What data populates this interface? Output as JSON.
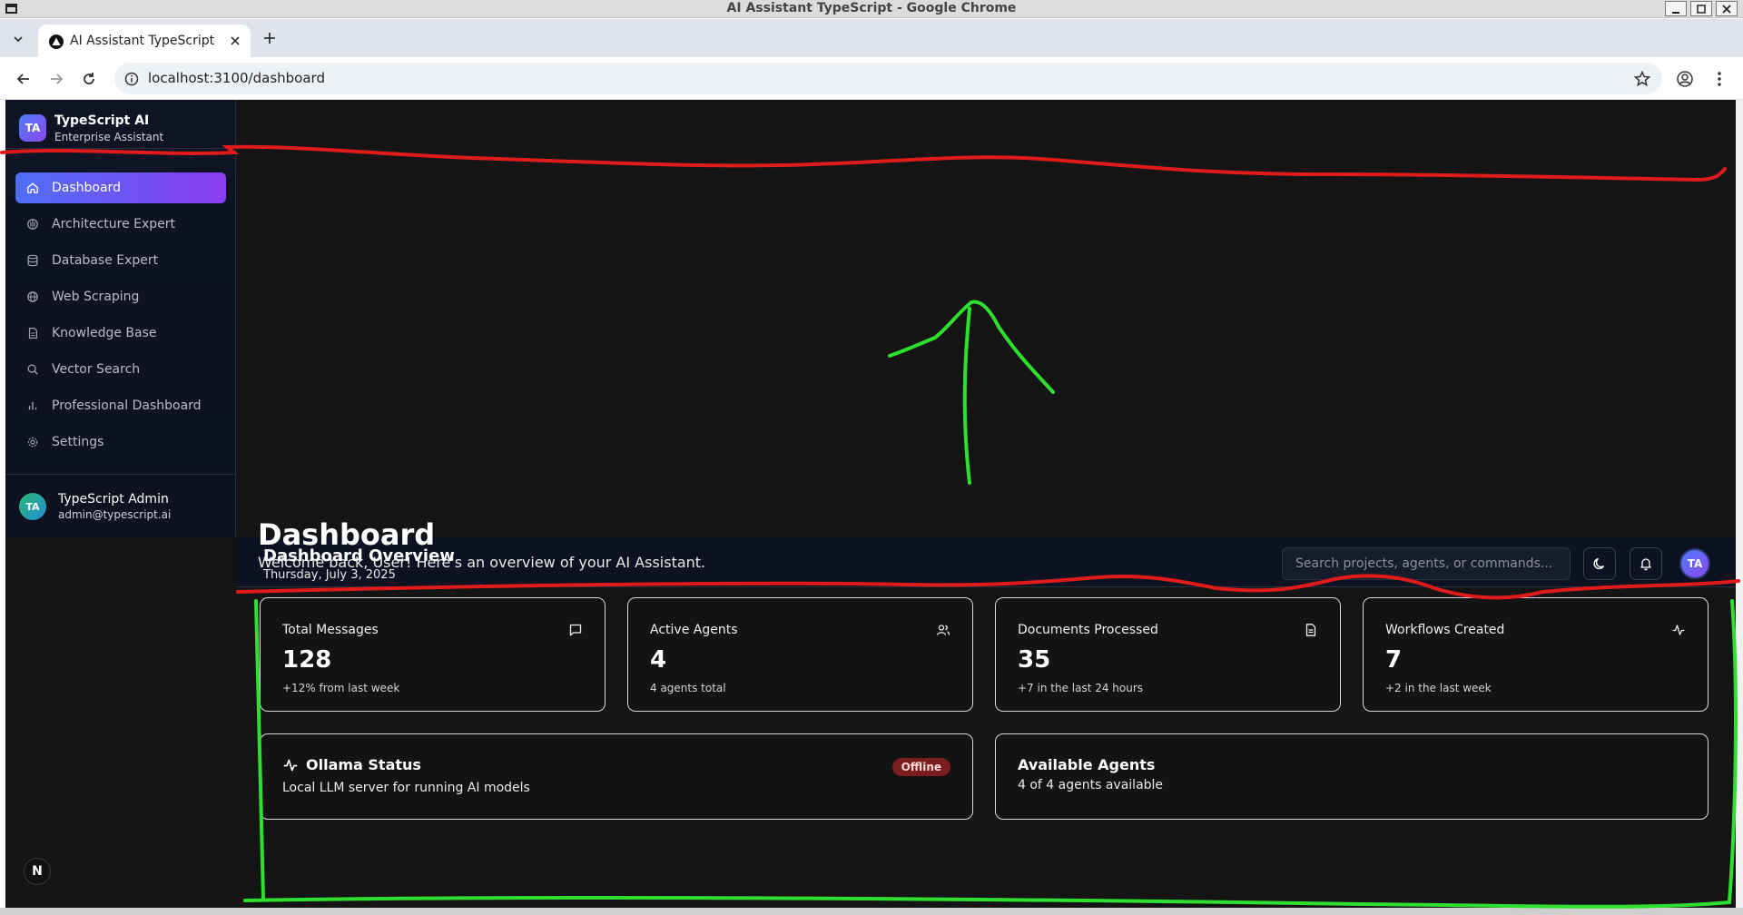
{
  "window": {
    "title": "AI Assistant TypeScript - Google Chrome"
  },
  "browser": {
    "tab_title": "AI Assistant TypeScript",
    "url": "localhost:3100/dashboard"
  },
  "sidebar": {
    "brand_logo": "TA",
    "brand_name": "TypeScript AI",
    "brand_sub": "Enterprise Assistant",
    "items": [
      {
        "label": "Dashboard",
        "icon": "home-icon",
        "active": true
      },
      {
        "label": "Architecture Expert",
        "icon": "brain-icon"
      },
      {
        "label": "Database Expert",
        "icon": "database-icon"
      },
      {
        "label": "Web Scraping",
        "icon": "globe-icon"
      },
      {
        "label": "Knowledge Base",
        "icon": "file-icon"
      },
      {
        "label": "Vector Search",
        "icon": "search-icon"
      },
      {
        "label": "Professional Dashboard",
        "icon": "bar-chart-icon"
      },
      {
        "label": "Settings",
        "icon": "gear-icon"
      }
    ],
    "user": {
      "initials": "TA",
      "name": "TypeScript Admin",
      "email": "admin@typescript.ai"
    }
  },
  "badge_n": "N",
  "header": {
    "title": "Dashboard Overview",
    "date": "Thursday, July 3, 2025",
    "search_placeholder": "Search projects, agents, or commands...",
    "avatar": "TA"
  },
  "main": {
    "title": "Dashboard",
    "subtitle": "Welcome back, User! Here's an overview of your AI Assistant.",
    "stats": [
      {
        "label": "Total Messages",
        "value": "128",
        "note": "+12% from last week",
        "icon": "message-icon"
      },
      {
        "label": "Active Agents",
        "value": "4",
        "note": "4 agents total",
        "icon": "users-icon"
      },
      {
        "label": "Documents Processed",
        "value": "35",
        "note": "+7 in the last 24 hours",
        "icon": "document-icon"
      },
      {
        "label": "Workflows Created",
        "value": "7",
        "note": "+2 in the last week",
        "icon": "activity-icon"
      }
    ],
    "ollama": {
      "title": "Ollama Status",
      "subtitle": "Local LLM server for running AI models",
      "status": "Offline"
    },
    "agents": {
      "title": "Available Agents",
      "subtitle": "4 of 4 agents available"
    }
  },
  "colors": {
    "accent_start": "#4f6ef7",
    "accent_end": "#8a3df2",
    "offline": "#7a1d1d"
  }
}
